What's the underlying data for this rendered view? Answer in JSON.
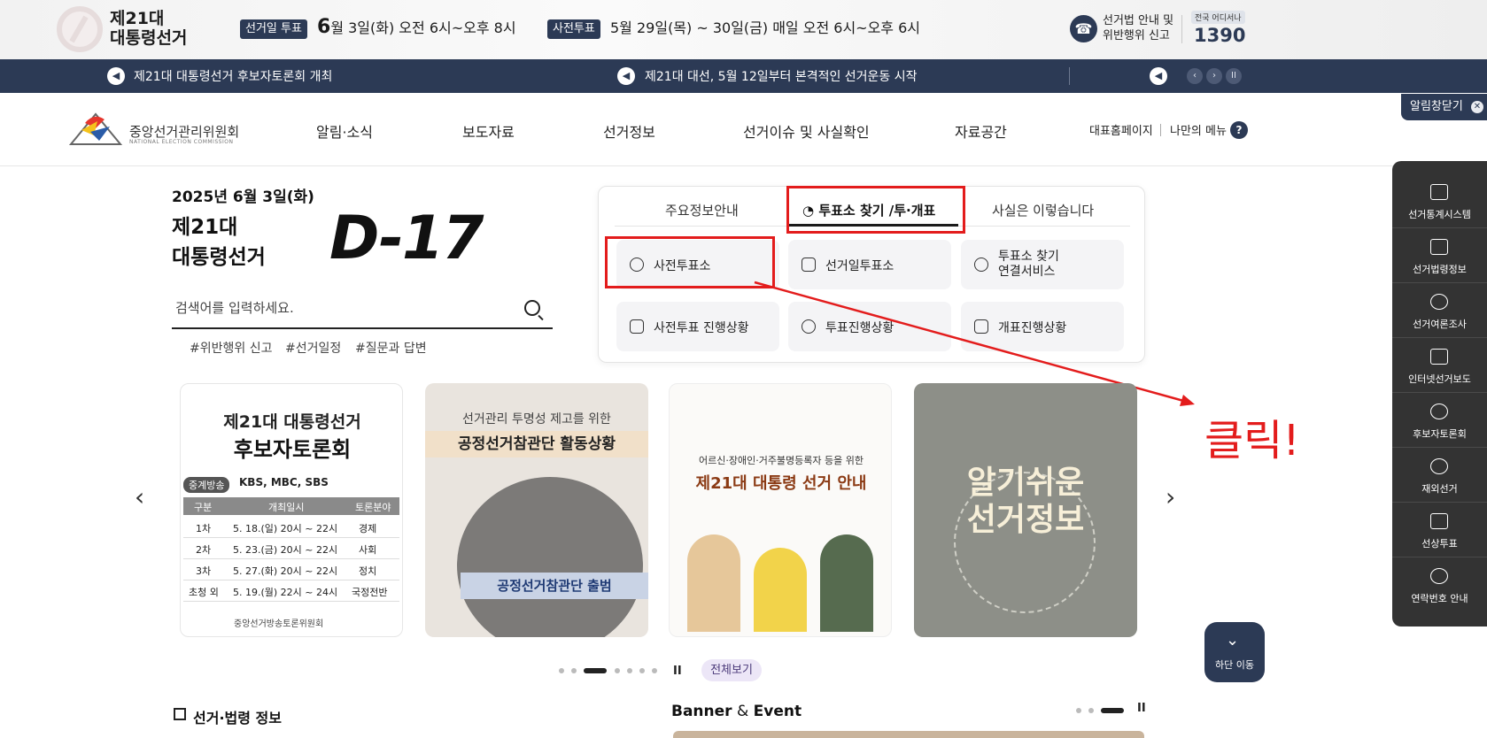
{
  "header": {
    "election_title_line1": "제21대",
    "election_title_line2": "대통령선거",
    "election_day_badge": "선거일 투표",
    "election_day_text_pre": "6",
    "election_day_text": "월 3일(화) 오전 6시~오후 8시",
    "early_vote_badge": "사전투표",
    "early_vote_text": "5월 29일(목) ~ 30일(금) 매일 오전 6시~오후 6시",
    "hotline_label_1": "선거법 안내 및",
    "hotline_label_2": "위반행위 신고",
    "hotline_small": "전국 어디서나",
    "hotline_number": "1390"
  },
  "newsbar": {
    "items": [
      "제21대 대통령선거 후보자토론회 개최",
      "제21대 대선, 5월 12일부터 본격적인 선거운동 시작"
    ],
    "prev": "‹",
    "next": "›",
    "pause": "II"
  },
  "nav": {
    "org_name": "중앙선거관리위원회",
    "org_sub": "NATIONAL ELECTION COMMISSION",
    "menu": [
      "알림·소식",
      "보도자료",
      "선거정보",
      "선거이슈 및 사실확인",
      "자료공간"
    ],
    "main_site": "대표홈페이지",
    "my_menu": "나만의 메뉴",
    "help": "?",
    "alert_close": "알림창닫기"
  },
  "hero": {
    "date": "2025년 6월 3일(화)",
    "title_line1": "제21대",
    "title_line2": "대통령선거",
    "dday": "D-17",
    "search_placeholder": "검색어를 입력하세요.",
    "tags": [
      "#위반행위 신고",
      "#선거일정",
      "#질문과 답변"
    ]
  },
  "panel": {
    "tabs": [
      "주요정보안내",
      "투표소 찾기 /투·개표",
      "사실은 이렇습니다"
    ],
    "active_tab": 1,
    "buttons": [
      "사전투표소",
      "선거일투표소",
      "투표소 찾기",
      "연결서비스",
      "사전투표 진행상황",
      "투표진행상황",
      "개표진행상황"
    ]
  },
  "annotation": {
    "click_text": "클릭!",
    "color": "#e31c1c"
  },
  "cards": {
    "c1_title1": "제21대  대통령선거",
    "c1_title2": "후보자토론회",
    "c1_broadcast_badge": "중계방송",
    "c1_broadcast": "KBS, MBC, SBS",
    "c1_headers": [
      "구분",
      "개최일시",
      "토론분야"
    ],
    "c1_rows": [
      [
        "1차",
        "5. 18.(일) 20시 ~ 22시",
        "경제"
      ],
      [
        "2차",
        "5. 23.(금) 20시 ~ 22시",
        "사회"
      ],
      [
        "3차",
        "5. 27.(화) 20시 ~ 22시",
        "정치"
      ],
      [
        "초청 외",
        "5. 19.(월) 22시 ~ 24시",
        "국정전반"
      ]
    ],
    "c1_footer": "중앙선거방송토론위원회",
    "c2_sub": "선거관리 투명성 제고를 위한",
    "c2_title": "공정선거참관단 활동상황",
    "c2_banner": "공정선거참관단 출범",
    "c3_sub": "어르신·장애인·거주불명등록자 등을 위한",
    "c3_title": "제21대 대통령 선거 안내",
    "c4_title1": "알기쉬운",
    "c4_title2": "선거정보",
    "arrow_left": "‹",
    "arrow_right": "›",
    "pause": "II",
    "view_all": "전체보기"
  },
  "bottom": {
    "law_title": "선거·법령 정보",
    "banner_title_a": "Banner",
    "banner_title_amp": " & ",
    "banner_title_b": "Event",
    "pause": "II"
  },
  "quick_panel": {
    "items": [
      "선거통계시스템",
      "선거법령정보",
      "선거여론조사",
      "인터넷선거보도",
      "후보자토론회",
      "재외선거",
      "선상투표",
      "연락번호 안내"
    ]
  },
  "down_button": {
    "label": "하단 이동",
    "icon": "⌄"
  },
  "colors": {
    "navy": "#2c3a55",
    "red": "#e31c1c"
  }
}
